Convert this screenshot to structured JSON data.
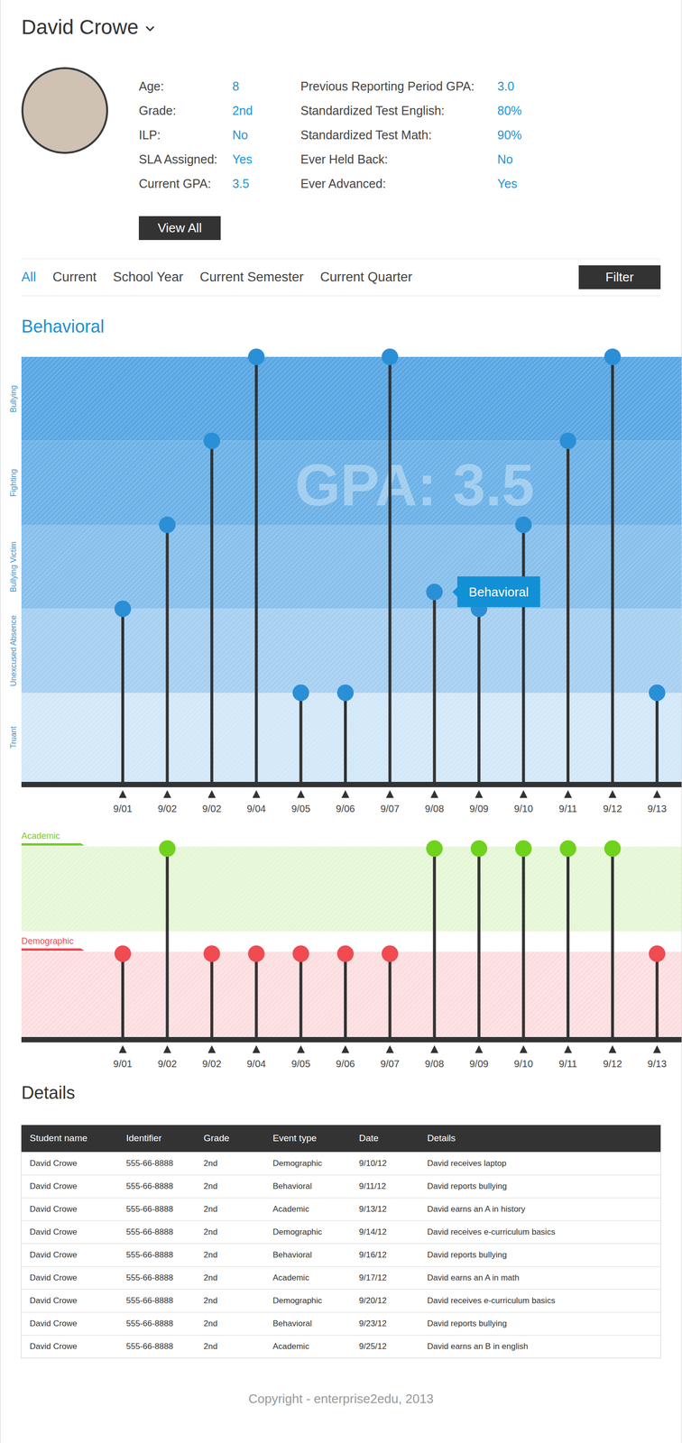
{
  "student": {
    "name": "David Crowe",
    "info_columns": [
      [
        {
          "label": "Age:",
          "value": "8"
        },
        {
          "label": "Grade:",
          "value": "2nd"
        },
        {
          "label": "ILP:",
          "value": "No"
        },
        {
          "label": "SLA Assigned:",
          "value": "Yes"
        },
        {
          "label": "Current GPA:",
          "value": "3.5"
        }
      ],
      [
        {
          "label": "Previous Reporting Period GPA:",
          "value": "3.0"
        },
        {
          "label": "Standardized Test English:",
          "value": "80%"
        },
        {
          "label": "Standardized Test Math:",
          "value": "90%"
        },
        {
          "label": "Ever Held Back:",
          "value": "No"
        },
        {
          "label": "Ever Advanced:",
          "value": "Yes"
        }
      ]
    ],
    "view_all_button": "View All"
  },
  "tabs": [
    {
      "label": "All",
      "selected": true
    },
    {
      "label": "Current",
      "selected": false
    },
    {
      "label": "School Year",
      "selected": false
    },
    {
      "label": "Current Semester",
      "selected": false
    },
    {
      "label": "Current Quarter",
      "selected": false
    }
  ],
  "filter_button": "Filter",
  "behavioral": {
    "title": "Behavioral",
    "watermark": "GPA: 3.5",
    "tooltip": "Behavioral",
    "categories": [
      {
        "label": "Bullying",
        "color": "#5aa7e3"
      },
      {
        "label": "Fighting",
        "color": "#6db2e7"
      },
      {
        "label": "Bullying Victim",
        "color": "#88c0ec"
      },
      {
        "label": "Unexcused Absence",
        "color": "#a7d0f1"
      },
      {
        "label": "Truant",
        "color": "#d3e8f8"
      }
    ],
    "points": [
      {
        "date": "9/01",
        "value": 2,
        "hovered": false
      },
      {
        "date": "9/02",
        "value": 3,
        "hovered": false
      },
      {
        "date": "9/02",
        "value": 4,
        "hovered": false
      },
      {
        "date": "9/04",
        "value": 5,
        "hovered": false
      },
      {
        "date": "9/05",
        "value": 1,
        "hovered": false
      },
      {
        "date": "9/06",
        "value": 1,
        "hovered": false
      },
      {
        "date": "9/07",
        "value": 5,
        "hovered": false
      },
      {
        "date": "9/08",
        "value": 2.2,
        "hovered": true
      },
      {
        "date": "9/09",
        "value": 2,
        "hovered": false
      },
      {
        "date": "9/10",
        "value": 3,
        "hovered": false
      },
      {
        "date": "9/11",
        "value": 4,
        "hovered": false
      },
      {
        "date": "9/12",
        "value": 5,
        "hovered": false
      },
      {
        "date": "9/13",
        "value": 1,
        "hovered": false
      }
    ]
  },
  "events_chart": {
    "series": [
      {
        "label": "Academic",
        "kind": "academic",
        "color": "#6fd21c"
      },
      {
        "label": "Demographic",
        "kind": "demographic",
        "color": "#f04a52"
      }
    ],
    "events": [
      {
        "date": "9/01",
        "kind": "demographic"
      },
      {
        "date": "9/02",
        "kind": "academic"
      },
      {
        "date": "9/02",
        "kind": "demographic"
      },
      {
        "date": "9/04",
        "kind": "demographic"
      },
      {
        "date": "9/05",
        "kind": "demographic"
      },
      {
        "date": "9/06",
        "kind": "demographic"
      },
      {
        "date": "9/07",
        "kind": "demographic"
      },
      {
        "date": "9/08",
        "kind": "academic"
      },
      {
        "date": "9/09",
        "kind": "academic"
      },
      {
        "date": "9/10",
        "kind": "academic"
      },
      {
        "date": "9/11",
        "kind": "academic"
      },
      {
        "date": "9/12",
        "kind": "academic"
      },
      {
        "date": "9/13",
        "kind": "demographic"
      }
    ]
  },
  "details": {
    "title": "Details",
    "columns": [
      "Student name",
      "Identifier",
      "Grade",
      "Event type",
      "Date",
      "Details"
    ],
    "rows": [
      [
        "David Crowe",
        "555-66-8888",
        "2nd",
        "Demographic",
        "9/10/12",
        "David receives laptop"
      ],
      [
        "David Crowe",
        "555-66-8888",
        "2nd",
        "Behavioral",
        "9/11/12",
        "David reports bullying"
      ],
      [
        "David Crowe",
        "555-66-8888",
        "2nd",
        "Academic",
        "9/13/12",
        "David earns an A in history"
      ],
      [
        "David Crowe",
        "555-66-8888",
        "2nd",
        "Demographic",
        "9/14/12",
        "David receives e-curriculum basics"
      ],
      [
        "David Crowe",
        "555-66-8888",
        "2nd",
        "Behavioral",
        "9/16/12",
        "David reports bullying"
      ],
      [
        "David Crowe",
        "555-66-8888",
        "2nd",
        "Academic",
        "9/17/12",
        "David earns an A in math"
      ],
      [
        "David Crowe",
        "555-66-8888",
        "2nd",
        "Demographic",
        "9/20/12",
        "David receives e-curriculum basics"
      ],
      [
        "David Crowe",
        "555-66-8888",
        "2nd",
        "Behavioral",
        "9/23/12",
        "David reports bullying"
      ],
      [
        "David Crowe",
        "555-66-8888",
        "2nd",
        "Academic",
        "9/25/12",
        "David earns an B in english"
      ]
    ]
  },
  "footer": "Copyright - enterprise2edu, 2013"
}
